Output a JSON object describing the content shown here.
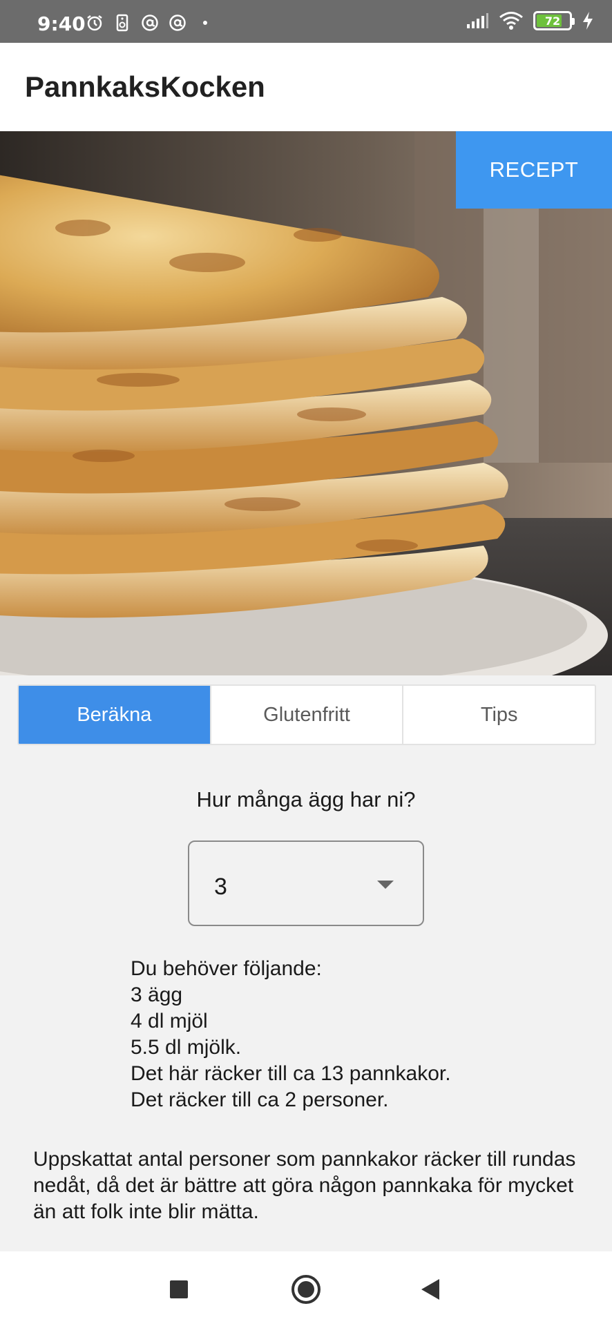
{
  "status_bar": {
    "time": "9:40",
    "battery_level": "72",
    "icons_left": [
      "alarm-icon",
      "speaker-icon",
      "at-sign-icon",
      "at-sign-icon",
      "dot-icon"
    ],
    "icons_right": [
      "signal-icon",
      "wifi-icon",
      "battery-icon",
      "charging-icon"
    ]
  },
  "app_bar": {
    "title": "PannkaksKocken"
  },
  "hero": {
    "image": "pancake-stack-photo",
    "button_label": "RECEPT",
    "button_color": "#3e97f0"
  },
  "tabs": [
    {
      "label": "Beräkna",
      "active": true
    },
    {
      "label": "Glutenfritt",
      "active": false
    },
    {
      "label": "Tips",
      "active": false
    }
  ],
  "calculator": {
    "question": "Hur många ägg har ni?",
    "selected_eggs": "3",
    "result_lines": [
      "Du behöver följande:",
      "3 ägg",
      "4 dl mjöl",
      "5.5 dl mjölk.",
      "Det här räcker till ca 13 pannkakor.",
      "Det räcker till ca 2 personer."
    ],
    "note": "Uppskattat antal personer som pannkakor räcker till rundas nedåt, då det är bättre att göra någon pannkaka för mycket än att folk inte blir mätta."
  },
  "nav_bar": {
    "buttons": [
      "recents-button",
      "home-button",
      "back-button"
    ]
  },
  "colors": {
    "accent": "#3e8ee8",
    "status_bar": "#6c6c6c",
    "battery": "#6ec13c"
  }
}
